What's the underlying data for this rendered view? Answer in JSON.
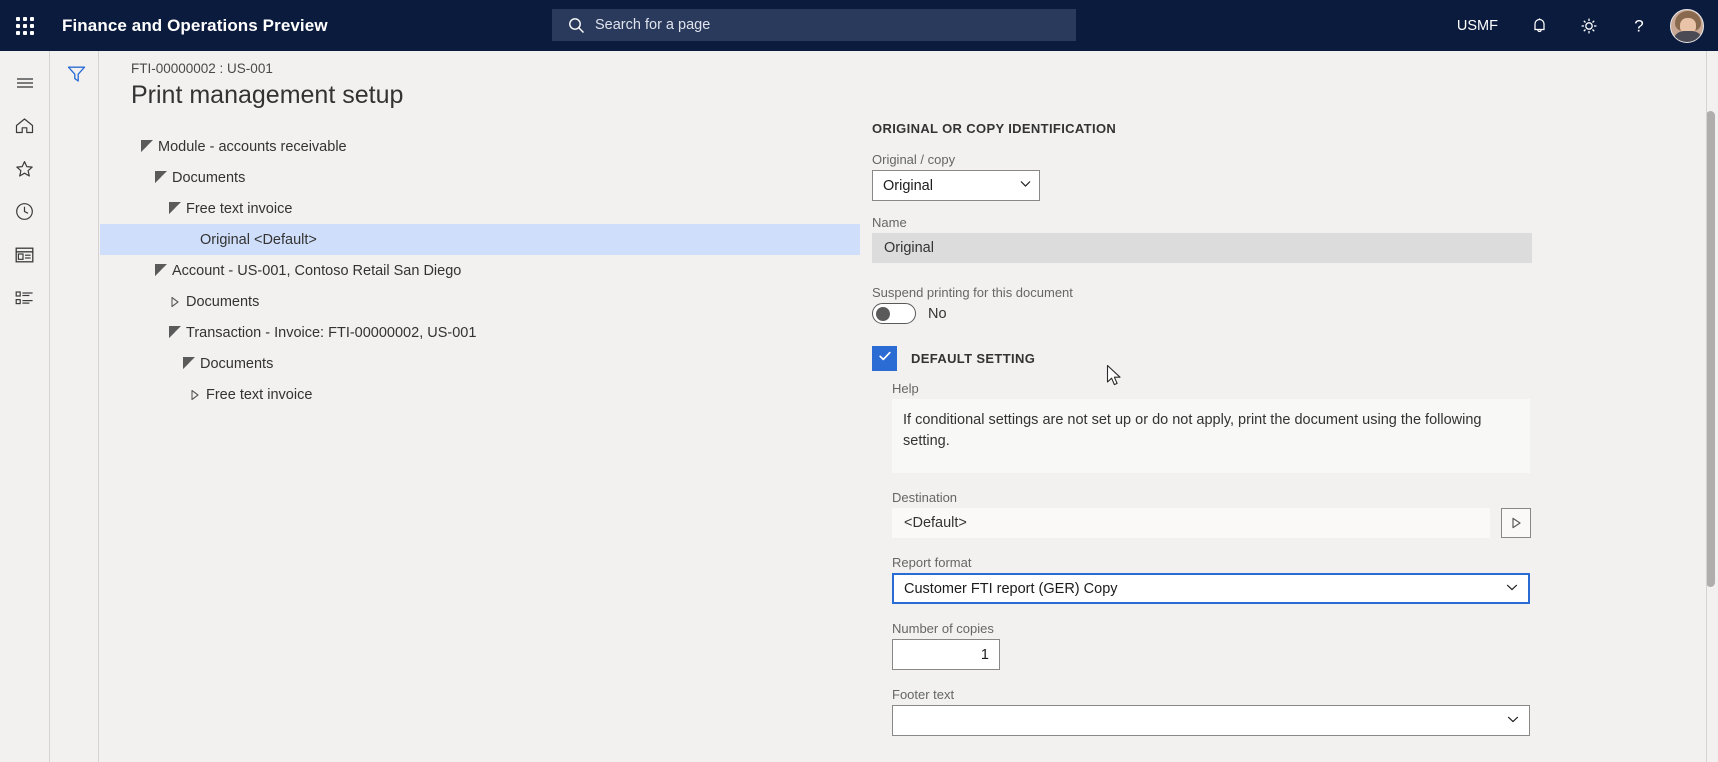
{
  "topbar": {
    "waffle_icon": "app-launcher-icon",
    "app_title": "Finance and Operations Preview",
    "search": {
      "icon": "search-icon",
      "placeholder": "Search for a page",
      "value": ""
    },
    "company": "USMF",
    "notifications_icon": "bell-icon",
    "settings_icon": "gear-icon",
    "help_icon": "question-mark-icon",
    "avatar": "user-avatar",
    "bg_color": "#0b1b3d",
    "search_bg_color": "#2a3a5c"
  },
  "rail": {
    "items": [
      {
        "icon": "hamburger-menu-icon",
        "label": "Expand navigation"
      },
      {
        "icon": "home-icon",
        "label": "Home"
      },
      {
        "icon": "star-icon",
        "label": "Favorites"
      },
      {
        "icon": "clock-icon",
        "label": "Recent"
      },
      {
        "icon": "workspace-icon",
        "label": "Workspaces"
      },
      {
        "icon": "modules-list-icon",
        "label": "Modules"
      }
    ]
  },
  "filter_strip": {
    "icon": "filter-funnel-icon",
    "label": "Show filters",
    "color": "#2b6cd4"
  },
  "page": {
    "breadcrumb": "FTI-00000002 : US-001",
    "title": "Print management setup"
  },
  "tree": {
    "nodes": [
      {
        "label": "Module - accounts receivable",
        "level": 1,
        "state": "expanded",
        "selected": false
      },
      {
        "label": "Documents",
        "level": 2,
        "state": "expanded",
        "selected": false
      },
      {
        "label": "Free text invoice",
        "level": 3,
        "state": "expanded",
        "selected": false
      },
      {
        "label": "Original <Default>",
        "level": 4,
        "state": "leaf",
        "selected": true
      },
      {
        "label": "Account - US-001, Contoso Retail San Diego",
        "level": 2,
        "state": "expanded",
        "selected": false
      },
      {
        "label": "Documents",
        "level": 3,
        "state": "collapsed",
        "selected": false
      },
      {
        "label": "Transaction - Invoice: FTI-00000002, US-001",
        "level": 3,
        "state": "expanded",
        "selected": false
      },
      {
        "label": "Documents",
        "level": 4,
        "state": "expanded",
        "selected": false
      },
      {
        "label": "Free text invoice",
        "level": 5,
        "state": "collapsed",
        "selected": false
      }
    ],
    "selection_color": "#cfdefa"
  },
  "form": {
    "section_title": "ORIGINAL OR COPY IDENTIFICATION",
    "original_copy": {
      "label": "Original / copy",
      "value": "Original",
      "chevron_icon": "chevron-down-icon"
    },
    "name": {
      "label": "Name",
      "value": "Original",
      "readonly": true
    },
    "suspend": {
      "label": "Suspend printing for this document",
      "value": "No",
      "checked": false
    },
    "default_setting": {
      "label": "DEFAULT SETTING",
      "checked": true,
      "check_icon": "checkmark-icon",
      "accent_color": "#2b6cd4"
    },
    "help": {
      "label": "Help",
      "text": "If conditional settings are not set up or do not apply, print the document using the following setting."
    },
    "destination": {
      "label": "Destination",
      "value": "<Default>",
      "run_button_icon": "play-triangle-icon"
    },
    "report_format": {
      "label": "Report format",
      "value": "Customer FTI report (GER) Copy",
      "chevron_icon": "chevron-down-icon",
      "focused": true
    },
    "number_of_copies": {
      "label": "Number of copies",
      "value": "1"
    },
    "footer_text": {
      "label": "Footer text",
      "value": "",
      "chevron_icon": "chevron-down-icon"
    }
  },
  "scrollbar": {
    "name": "vertical-scrollbar"
  },
  "cursor": {
    "name": "mouse-pointer"
  }
}
